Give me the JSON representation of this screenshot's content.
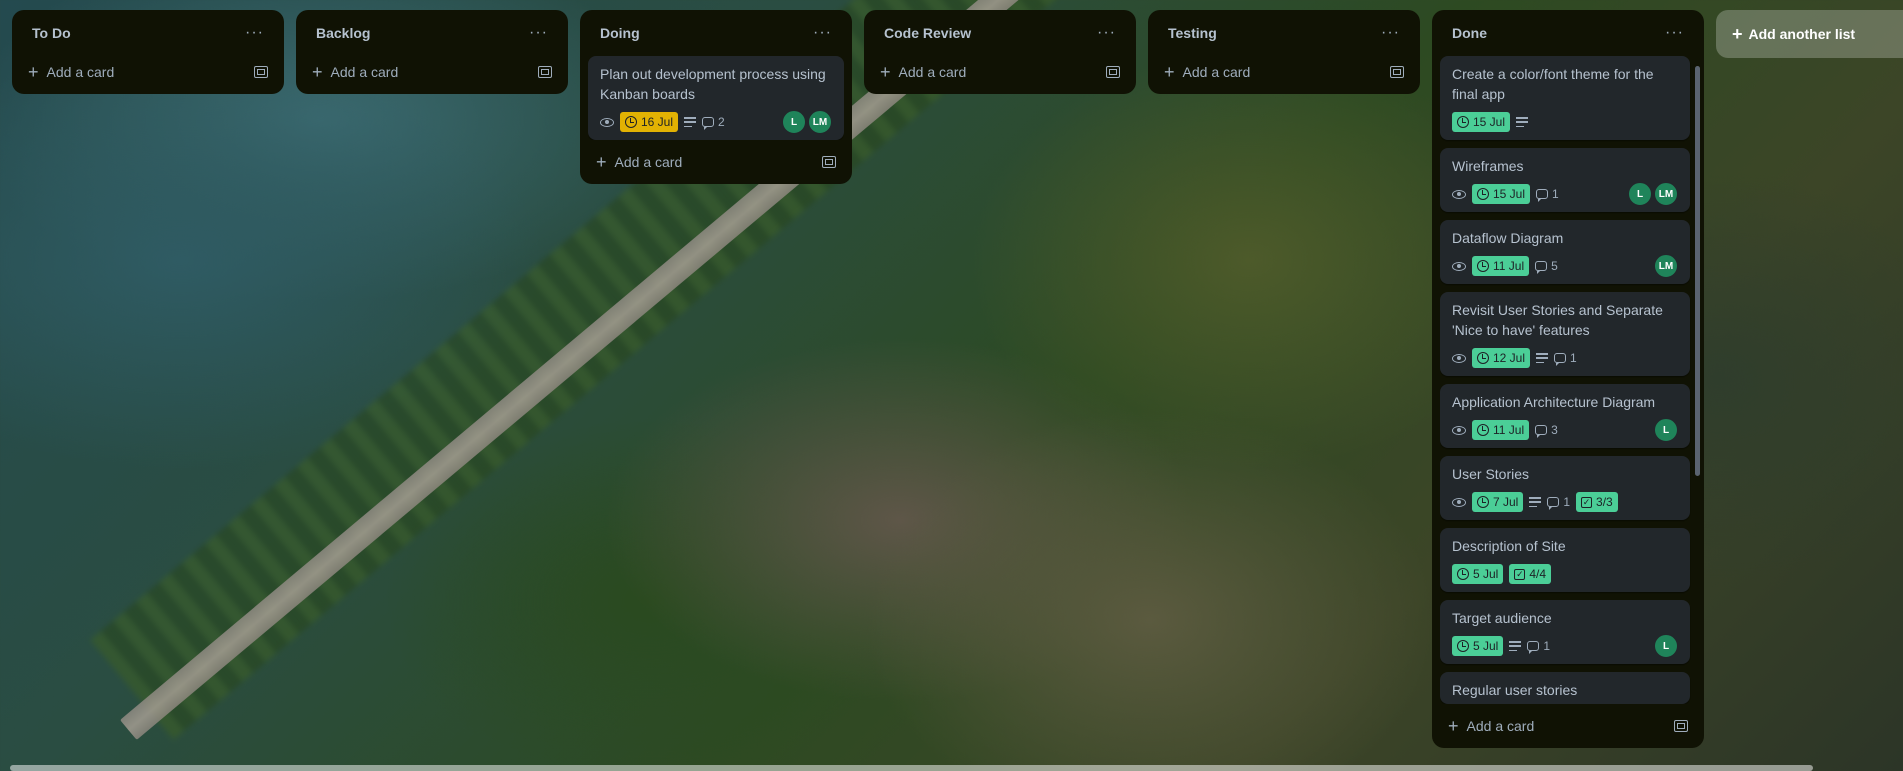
{
  "lists": {
    "todo": {
      "title": "To Do",
      "add_card": "Add a card"
    },
    "backlog": {
      "title": "Backlog",
      "add_card": "Add a card"
    },
    "doing": {
      "title": "Doing",
      "add_card": "Add a card",
      "cards": [
        {
          "title": "Plan out development process using Kanban boards",
          "date": "16 Jul",
          "comments": "2",
          "members": [
            "L",
            "LM"
          ]
        }
      ]
    },
    "code_review": {
      "title": "Code Review",
      "add_card": "Add a card"
    },
    "testing": {
      "title": "Testing",
      "add_card": "Add a card"
    },
    "done": {
      "title": "Done",
      "add_card": "Add a card",
      "cards": [
        {
          "title": "Create a color/font theme for the final app",
          "date": "15 Jul"
        },
        {
          "title": "Wireframes",
          "date": "15 Jul",
          "comments": "1",
          "members": [
            "L",
            "LM"
          ]
        },
        {
          "title": "Dataflow Diagram",
          "date": "11 Jul",
          "comments": "5",
          "members": [
            "LM"
          ]
        },
        {
          "title": "Revisit User Stories and Separate 'Nice to have' features",
          "date": "12 Jul",
          "comments": "1"
        },
        {
          "title": "Application Architecture Diagram",
          "date": "11 Jul",
          "comments": "3",
          "members": [
            "L"
          ]
        },
        {
          "title": "User Stories",
          "date": "7 Jul",
          "comments": "1",
          "checklist": "3/3"
        },
        {
          "title": "Description of Site",
          "date": "5 Jul",
          "checklist": "4/4"
        },
        {
          "title": "Target audience",
          "date": "5 Jul",
          "comments": "1",
          "members": [
            "L"
          ]
        },
        {
          "title": "Regular user stories"
        }
      ]
    }
  },
  "add_list_label": "Add another list",
  "more_label": "···",
  "plus_label": "+",
  "colors": {
    "list_bg": "#101204",
    "card_bg": "#22272b",
    "date_green": "#4bce97",
    "date_due": "#e2b203",
    "avatar": "#1f845a"
  }
}
